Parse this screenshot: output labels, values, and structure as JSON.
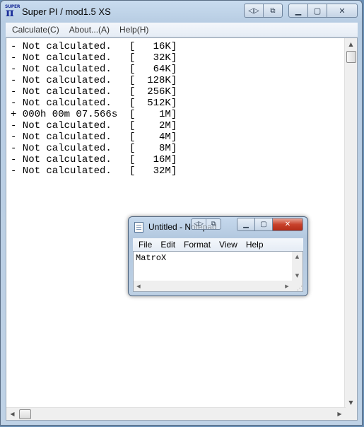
{
  "superpi": {
    "title": "Super PI / mod1.5 XS",
    "icon_text": "SUPER",
    "icon_glyph": "π",
    "menu": [
      "Calculate(C)",
      "About...(A)",
      "Help(H)"
    ],
    "results": [
      {
        "prefix": "-",
        "status": "Not calculated.",
        "size": "16K"
      },
      {
        "prefix": "-",
        "status": "Not calculated.",
        "size": "32K"
      },
      {
        "prefix": "-",
        "status": "Not calculated.",
        "size": "64K"
      },
      {
        "prefix": "-",
        "status": "Not calculated.",
        "size": "128K"
      },
      {
        "prefix": "-",
        "status": "Not calculated.",
        "size": "256K"
      },
      {
        "prefix": "-",
        "status": "Not calculated.",
        "size": "512K"
      },
      {
        "prefix": "+",
        "status": "000h 00m 07.566s",
        "size": "1M"
      },
      {
        "prefix": "-",
        "status": "Not calculated.",
        "size": "2M"
      },
      {
        "prefix": "-",
        "status": "Not calculated.",
        "size": "4M"
      },
      {
        "prefix": "-",
        "status": "Not calculated.",
        "size": "8M"
      },
      {
        "prefix": "-",
        "status": "Not calculated.",
        "size": "16M"
      },
      {
        "prefix": "-",
        "status": "Not calculated.",
        "size": "32M"
      }
    ]
  },
  "notepad": {
    "title": "Untitled - Notepad",
    "menu": [
      "File",
      "Edit",
      "Format",
      "View",
      "Help"
    ],
    "content": "MatroX"
  },
  "colors": {
    "close_button": "#c8412b",
    "title_bar": "#c9dcef",
    "text": "#000000"
  }
}
